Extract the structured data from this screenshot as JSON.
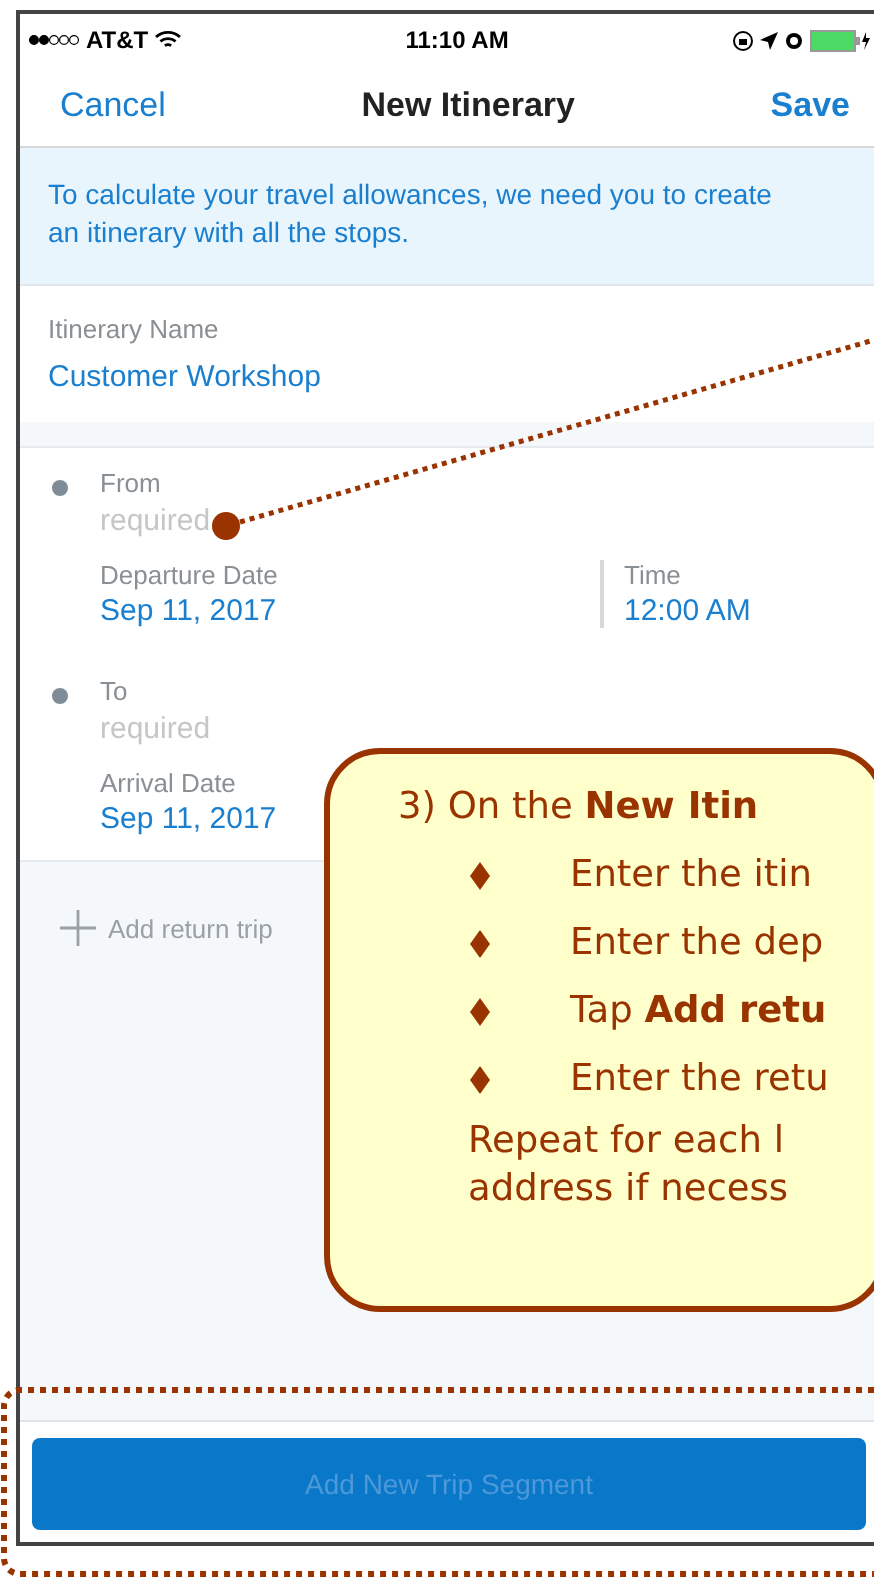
{
  "status_bar": {
    "carrier": "AT&T",
    "time": "11:10 AM"
  },
  "nav": {
    "cancel": "Cancel",
    "title": "New Itinerary",
    "save": "Save"
  },
  "info_banner": "To calculate your travel allowances, we need you to create an itinerary with all the stops.",
  "itinerary_name": {
    "label": "Itinerary Name",
    "value": "Customer Workshop"
  },
  "stops": [
    {
      "label": "From",
      "placeholder": "required",
      "date_label": "Departure Date",
      "date": "Sep 11, 2017",
      "time_label": "Time",
      "time": "12:00 AM"
    },
    {
      "label": "To",
      "placeholder": "required",
      "date_label": "Arrival Date",
      "date": "Sep 11, 2017"
    }
  ],
  "add_return_trip": "Add return trip",
  "add_segment_button": {
    "label": "Add New Trip Segment",
    "disabled": true
  },
  "callout": {
    "heading": "3) On the **New Itin**",
    "bullets": [
      "Enter the itin",
      "Enter the dep",
      "Tap **Add retu**",
      "Enter the retu"
    ],
    "footer": [
      "Repeat for each l",
      "address if necess"
    ]
  }
}
